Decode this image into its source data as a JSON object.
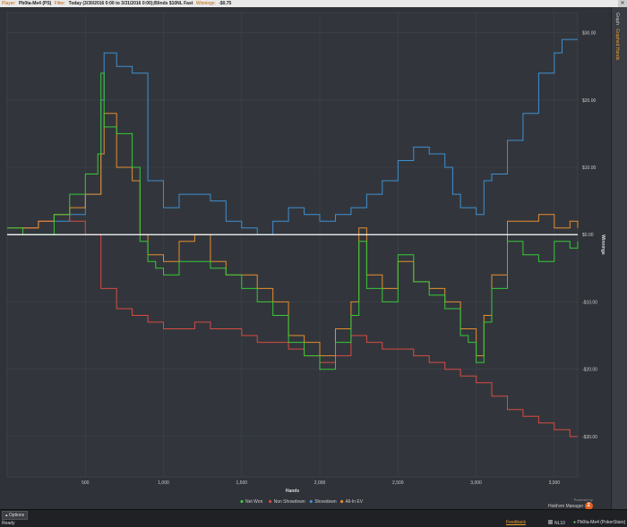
{
  "topbar": {
    "player_label": "Player:",
    "player_value": "Pb0ta-Me4 (PS)",
    "filter_label": "Filter:",
    "filter_value": "Today (3/30/2016 0:00 to 3/31/2016 0:00);Blinds $10NL Fast",
    "winnings_label": "Winnings:",
    "winnings_value": "-$0.75"
  },
  "side_tabs": {
    "graph": "Graph",
    "graphed_hands": "Graphed Hands"
  },
  "bottom": {
    "options_label": "Options",
    "status": "Ready",
    "feedback": "Feedback",
    "limit": "NL10",
    "player": "Pb0ta-Me4 (PokerStars)",
    "brand_powered": "Powered by",
    "brand_name": "Hold'em Manager",
    "brand_version": "2"
  },
  "colors": {
    "net_won": "#38c838",
    "non_showdown": "#d84b42",
    "showdown": "#3f8fd0",
    "all_in_ev": "#e68c2e",
    "zero_line": "#ffffff"
  },
  "chart_data": {
    "type": "line",
    "xlabel": "Hands",
    "ylabel": "Winnings",
    "xlim": [
      0,
      3650
    ],
    "ylim": [
      -36,
      33
    ],
    "x_ticks": [
      500,
      1000,
      1500,
      2000,
      2500,
      3000,
      3500
    ],
    "x_tick_labels": [
      "500",
      "1,000",
      "1,500",
      "2,000",
      "2,500",
      "3,000",
      "3,500"
    ],
    "y_ticks": [
      30,
      20,
      10,
      0,
      -10,
      -20,
      -30
    ],
    "y_tick_labels": [
      "$30.00",
      "$20.00",
      "$10.00",
      "$0.00",
      "-$10.00",
      "-$20.00",
      "-$30.00"
    ],
    "legend_position": "bottom-center",
    "grid": true,
    "series": [
      {
        "name": "Net Won",
        "x": [
          0,
          100,
          200,
          300,
          400,
          500,
          580,
          600,
          620,
          700,
          800,
          850,
          900,
          950,
          1000,
          1100,
          1200,
          1300,
          1400,
          1500,
          1600,
          1700,
          1800,
          1900,
          2000,
          2100,
          2200,
          2250,
          2300,
          2400,
          2500,
          2600,
          2700,
          2800,
          2900,
          2950,
          3000,
          3050,
          3100,
          3200,
          3300,
          3400,
          3500,
          3600,
          3650
        ],
        "y": [
          1,
          0,
          0,
          3,
          6,
          9,
          12,
          24,
          16,
          15,
          10,
          -1,
          -4,
          -5,
          -6,
          -4,
          -4,
          -5,
          -6,
          -8,
          -10,
          -12,
          -16,
          -18,
          -20,
          -16,
          -12,
          -1,
          -8,
          -10,
          -3,
          -7,
          -9,
          -11,
          -15,
          -16,
          -19,
          -13,
          -8,
          -1,
          -3,
          -4,
          -1,
          -2,
          -1
        ]
      },
      {
        "name": "Non Showdown",
        "x": [
          0,
          100,
          200,
          300,
          400,
          500,
          600,
          700,
          800,
          900,
          1000,
          1100,
          1200,
          1300,
          1400,
          1500,
          1600,
          1700,
          1800,
          1900,
          2000,
          2100,
          2200,
          2300,
          2400,
          2500,
          2600,
          2700,
          2800,
          2900,
          3000,
          3100,
          3200,
          3300,
          3400,
          3500,
          3600,
          3650
        ],
        "y": [
          0,
          1,
          2,
          3,
          2,
          0,
          -8,
          -11,
          -12,
          -13,
          -14,
          -14,
          -13,
          -14,
          -14,
          -15,
          -16,
          -16,
          -17,
          -18,
          -19,
          -18,
          -15,
          -16,
          -17,
          -17,
          -18,
          -19,
          -20,
          -21,
          -22,
          -24,
          -26,
          -27,
          -28,
          -29,
          -30,
          -30
        ]
      },
      {
        "name": "Showdown",
        "x": [
          0,
          100,
          200,
          300,
          400,
          500,
          600,
          620,
          700,
          800,
          900,
          1000,
          1100,
          1200,
          1300,
          1400,
          1500,
          1600,
          1700,
          1800,
          1900,
          2000,
          2100,
          2200,
          2300,
          2400,
          2500,
          2600,
          2700,
          2800,
          2850,
          2900,
          3000,
          3050,
          3100,
          3200,
          3300,
          3400,
          3500,
          3550,
          3600,
          3650
        ],
        "y": [
          0,
          1,
          2,
          2,
          3,
          6,
          20,
          27,
          25,
          24,
          8,
          4,
          6,
          6,
          5,
          2,
          1,
          0,
          2,
          4,
          3,
          2,
          3,
          4,
          6,
          8,
          11,
          13,
          12,
          10,
          6,
          4,
          3,
          8,
          9,
          14,
          18,
          24,
          27,
          29,
          29,
          29
        ]
      },
      {
        "name": "All-In EV",
        "x": [
          0,
          100,
          200,
          300,
          400,
          500,
          600,
          620,
          700,
          800,
          850,
          900,
          950,
          1000,
          1100,
          1200,
          1300,
          1400,
          1500,
          1600,
          1700,
          1800,
          1900,
          2000,
          2100,
          2200,
          2250,
          2300,
          2400,
          2500,
          2600,
          2700,
          2800,
          2900,
          3000,
          3050,
          3100,
          3200,
          3300,
          3400,
          3500,
          3600,
          3650
        ],
        "y": [
          1,
          1,
          2,
          3,
          4,
          6,
          12,
          18,
          10,
          8,
          0,
          -3,
          -3,
          -4,
          -1,
          0,
          -4,
          -6,
          -6,
          -8,
          -10,
          -15,
          -16,
          -18,
          -14,
          -10,
          1,
          -6,
          -8,
          -4,
          -7,
          -8,
          -10,
          -14,
          -18,
          -12,
          -6,
          2,
          2,
          3,
          1,
          2,
          1
        ]
      }
    ]
  }
}
